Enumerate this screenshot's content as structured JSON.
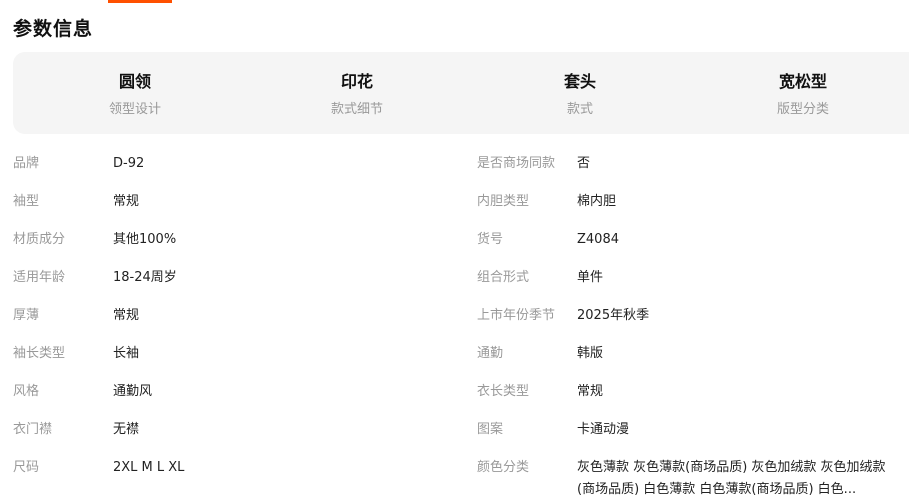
{
  "section_title": "参数信息",
  "colors": {
    "accent": "#ff5000",
    "card_bg": "#f5f5f5",
    "label": "#999999",
    "value": "#222222"
  },
  "highlights": [
    {
      "value": "圆领",
      "label": "领型设计"
    },
    {
      "value": "印花",
      "label": "款式细节"
    },
    {
      "value": "套头",
      "label": "款式"
    },
    {
      "value": "宽松型",
      "label": "版型分类"
    }
  ],
  "rows": [
    {
      "left": {
        "label": "品牌",
        "value": "D-92"
      },
      "right": {
        "label": "是否商场同款",
        "value": "否"
      }
    },
    {
      "left": {
        "label": "袖型",
        "value": "常规"
      },
      "right": {
        "label": "内胆类型",
        "value": "棉内胆"
      }
    },
    {
      "left": {
        "label": "材质成分",
        "value": "其他100%"
      },
      "right": {
        "label": "货号",
        "value": "Z4084"
      }
    },
    {
      "left": {
        "label": "适用年龄",
        "value": "18-24周岁"
      },
      "right": {
        "label": "组合形式",
        "value": "单件"
      }
    },
    {
      "left": {
        "label": "厚薄",
        "value": "常规"
      },
      "right": {
        "label": "上市年份季节",
        "value": "2025年秋季"
      }
    },
    {
      "left": {
        "label": "袖长类型",
        "value": "长袖"
      },
      "right": {
        "label": "通勤",
        "value": "韩版"
      }
    },
    {
      "left": {
        "label": "风格",
        "value": "通勤风"
      },
      "right": {
        "label": "衣长类型",
        "value": "常规"
      }
    },
    {
      "left": {
        "label": "衣门襟",
        "value": "无襟"
      },
      "right": {
        "label": "图案",
        "value": "卡通动漫"
      }
    },
    {
      "left": {
        "label": "尺码",
        "value": "2XL M L XL"
      },
      "right": {
        "label": "颜色分类",
        "value": "灰色薄款 灰色薄款(商场品质) 灰色加绒款 灰色加绒款(商场品质) 白色薄款 白色薄款(商场品质) 白色..."
      }
    }
  ]
}
